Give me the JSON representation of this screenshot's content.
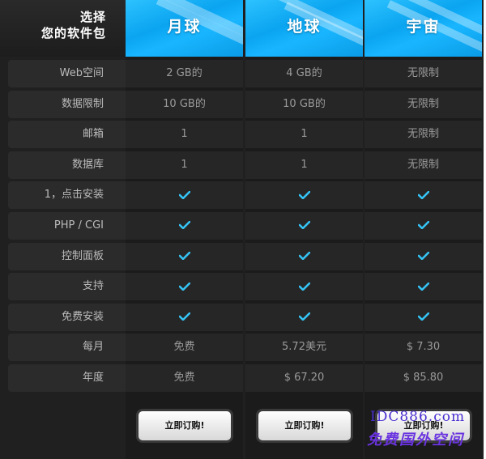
{
  "header": {
    "title_line1": "选择",
    "title_line2": "您的软件包",
    "plans": [
      "月球",
      "地球",
      "宇宙"
    ]
  },
  "rows": [
    {
      "label": "Web空间",
      "values": [
        "2 GB的",
        "4 GB的",
        "无限制"
      ]
    },
    {
      "label": "数据限制",
      "values": [
        "10 GB的",
        "10 GB的",
        "无限制"
      ]
    },
    {
      "label": "邮箱",
      "values": [
        "1",
        "1",
        "无限制"
      ]
    },
    {
      "label": "数据库",
      "values": [
        "1",
        "1",
        "无限制"
      ]
    },
    {
      "label": "1，点击安装",
      "values": [
        "check",
        "check",
        "check"
      ]
    },
    {
      "label": "PHP / CGI",
      "values": [
        "check",
        "check",
        "check"
      ]
    },
    {
      "label": "控制面板",
      "values": [
        "check",
        "check",
        "check"
      ]
    },
    {
      "label": "支持",
      "values": [
        "check",
        "check",
        "check"
      ]
    },
    {
      "label": "免费安装",
      "values": [
        "check",
        "check",
        "check"
      ]
    },
    {
      "label": "每月",
      "values": [
        "免费",
        "5.72美元",
        "$ 7.30"
      ]
    },
    {
      "label": "年度",
      "values": [
        "免费",
        "$ 67.20",
        "$ 85.80"
      ]
    }
  ],
  "buttons": {
    "order_label": "立即订购!"
  },
  "watermark": {
    "line1": "IDC886.com",
    "line2": "免费国外空间"
  },
  "colors": {
    "accent_blue": "#14aefc",
    "check_color": "#35c4f5",
    "panel_bg": "#202020"
  }
}
